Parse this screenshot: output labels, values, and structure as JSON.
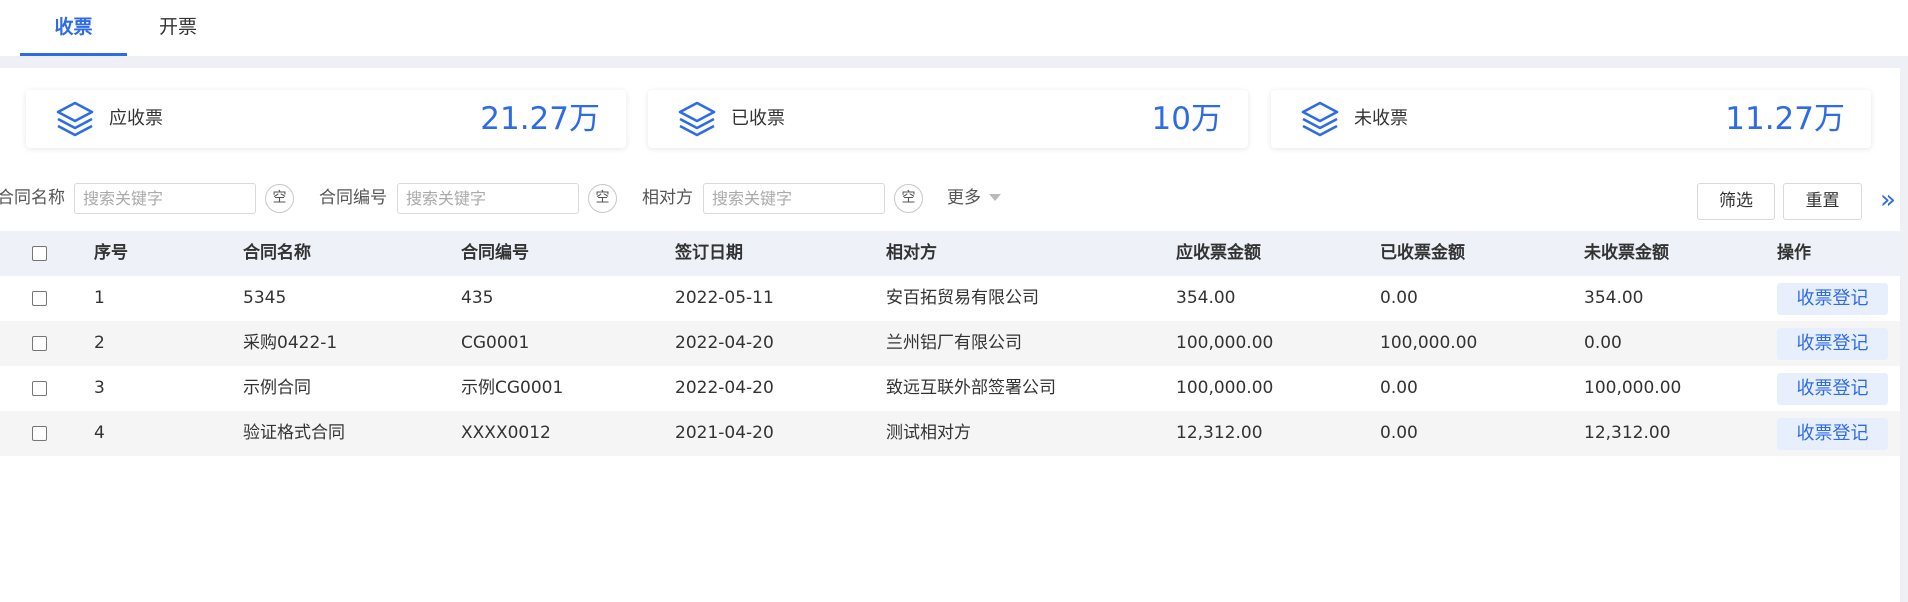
{
  "tabs": [
    {
      "label": "收票",
      "active": true
    },
    {
      "label": "开票",
      "active": false
    }
  ],
  "stats": [
    {
      "label": "应收票",
      "value": "21.27万",
      "icon": "layers-icon"
    },
    {
      "label": "已收票",
      "value": "10万",
      "icon": "layers-icon"
    },
    {
      "label": "未收票",
      "value": "11.27万",
      "icon": "layers-icon"
    }
  ],
  "filters": {
    "fields": [
      {
        "label": "合同名称",
        "placeholder": "搜索关键字",
        "value": "",
        "clear_label": "空"
      },
      {
        "label": "合同编号",
        "placeholder": "搜索关键字",
        "value": "",
        "clear_label": "空"
      },
      {
        "label": "相对方",
        "placeholder": "搜索关键字",
        "value": "",
        "clear_label": "空"
      }
    ],
    "more_label": "更多",
    "filter_button": "筛选",
    "reset_button": "重置",
    "expand_glyph": "»"
  },
  "table": {
    "columns": [
      "序号",
      "合同名称",
      "合同编号",
      "签订日期",
      "相对方",
      "应收票金额",
      "已收票金额",
      "未收票金额",
      "操作"
    ],
    "rows": [
      {
        "no": "1",
        "name": "5345",
        "code": "435",
        "date": "2022-05-11",
        "party": "安百拓贸易有限公司",
        "due": "354.00",
        "received": "0.00",
        "remaining": "354.00",
        "action": "收票登记"
      },
      {
        "no": "2",
        "name": "采购0422-1",
        "code": "CG0001",
        "date": "2022-04-20",
        "party": "兰州铝厂有限公司",
        "due": "100,000.00",
        "received": "100,000.00",
        "remaining": "0.00",
        "action": "收票登记"
      },
      {
        "no": "3",
        "name": "示例合同",
        "code": "示例CG0001",
        "date": "2022-04-20",
        "party": "致远互联外部签署公司",
        "due": "100,000.00",
        "received": "0.00",
        "remaining": "100,000.00",
        "action": "收票登记"
      },
      {
        "no": "4",
        "name": "验证格式合同",
        "code": "XXXX0012",
        "date": "2021-04-20",
        "party": "测试相对方",
        "due": "12,312.00",
        "received": "0.00",
        "remaining": "12,312.00",
        "action": "收票登记"
      }
    ]
  },
  "colors": {
    "accent": "#2e6be6",
    "header_bg": "#eef1f8",
    "action_bg": "#e8effc"
  }
}
